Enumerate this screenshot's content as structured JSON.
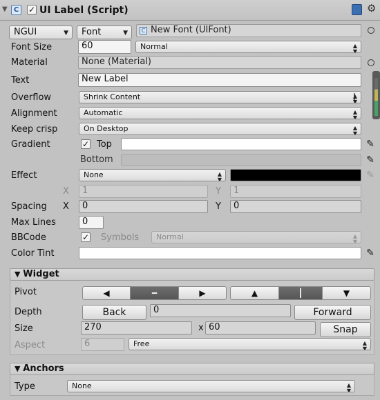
{
  "header": {
    "title": "UI Label (Script)",
    "enabled": true
  },
  "font": {
    "type_option": "NGUI",
    "kind_option": "Font",
    "value": "New Font (UIFont)"
  },
  "font_size": {
    "label": "Font Size",
    "value": "60",
    "style": "Normal"
  },
  "material": {
    "label": "Material",
    "value": "None (Material)"
  },
  "text": {
    "label": "Text",
    "value": "New Label"
  },
  "overflow": {
    "label": "Overflow",
    "value": "Shrink Content"
  },
  "alignment": {
    "label": "Alignment",
    "value": "Automatic"
  },
  "keep_crisp": {
    "label": "Keep crisp",
    "value": "On Desktop"
  },
  "gradient": {
    "label": "Gradient",
    "enabled": true,
    "top_label": "Top",
    "top_color": "#ffffff",
    "bottom_label": "Bottom",
    "bottom_color": "#bdbdbd"
  },
  "effect": {
    "label": "Effect",
    "value": "None",
    "color": "#000000",
    "x_label": "X",
    "x_value": "1",
    "y_label": "Y",
    "y_value": "1"
  },
  "spacing": {
    "label": "Spacing",
    "x_label": "X",
    "x_value": "0",
    "y_label": "Y",
    "y_value": "0"
  },
  "max_lines": {
    "label": "Max Lines",
    "value": "0"
  },
  "bbcode": {
    "label": "BBCode",
    "enabled": true,
    "symbols_label": "Symbols",
    "symbols_value": "Normal"
  },
  "color_tint": {
    "label": "Color Tint",
    "color": "#ffffff"
  },
  "widget": {
    "title": "Widget",
    "pivot_label": "Pivot",
    "depth_label": "Depth",
    "back_label": "Back",
    "depth_value": "0",
    "forward_label": "Forward",
    "size_label": "Size",
    "width": "270",
    "x_sep": "x",
    "height": "60",
    "snap_label": "Snap",
    "aspect_label": "Aspect",
    "aspect_value": "6",
    "aspect_mode": "Free"
  },
  "anchors": {
    "title": "Anchors",
    "type_label": "Type",
    "type_value": "None"
  },
  "colors": {
    "background": "#c2c2c2",
    "pivot_selected": "#5f5f5f"
  }
}
